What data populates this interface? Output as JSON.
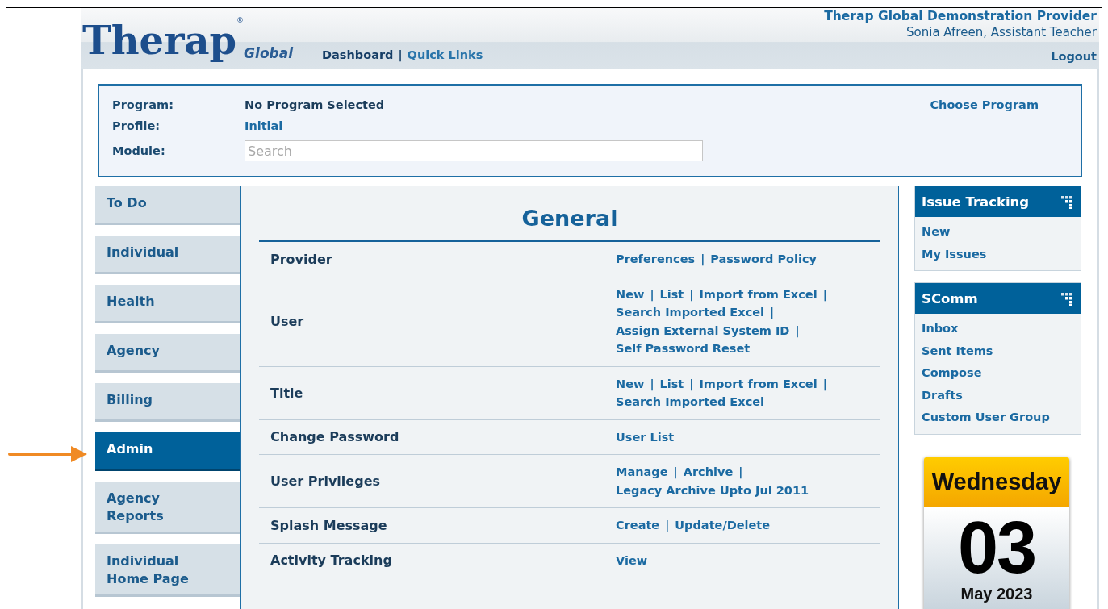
{
  "header": {
    "logo": {
      "name": "Therap",
      "mark": "®",
      "suffix": "Global"
    },
    "nav_links": [
      {
        "label": "Dashboard",
        "selected": true
      },
      {
        "label": "Quick Links",
        "selected": false
      }
    ],
    "separator": "|",
    "provider": "Therap Global Demonstration Provider",
    "user": "Sonia Afreen, Assistant Teacher",
    "logout": "Logout"
  },
  "context": {
    "program_label": "Program:",
    "program_value": "No Program Selected",
    "profile_label": "Profile:",
    "profile_value": "Initial",
    "module_label": "Module:",
    "module_search": {
      "placeholder": "Search"
    },
    "choose_program": "Choose Program"
  },
  "sidebar": {
    "items": [
      {
        "label": "To Do",
        "selected": false
      },
      {
        "label": "Individual",
        "selected": false
      },
      {
        "label": "Health",
        "selected": false
      },
      {
        "label": "Agency",
        "selected": false
      },
      {
        "label": "Billing",
        "selected": false
      },
      {
        "label": "Admin",
        "selected": true
      },
      {
        "label": "Agency Reports",
        "selected": false
      },
      {
        "label": "Individual Home Page",
        "selected": false
      }
    ]
  },
  "main": {
    "title": "General",
    "separator": "|",
    "rows": [
      {
        "label": "Provider",
        "lines": [
          [
            "Preferences",
            "Password Policy"
          ]
        ]
      },
      {
        "label": "User",
        "lines": [
          [
            "New",
            "List",
            "Import from Excel"
          ],
          [
            "Search Imported Excel"
          ],
          [
            "Assign External System ID"
          ],
          [
            "Self Password Reset"
          ]
        ]
      },
      {
        "label": "Title",
        "lines": [
          [
            "New",
            "List",
            "Import from Excel"
          ],
          [
            "Search Imported Excel"
          ]
        ]
      },
      {
        "label": "Change Password",
        "lines": [
          [
            "User List"
          ]
        ]
      },
      {
        "label": "User Privileges",
        "lines": [
          [
            "Manage",
            "Archive"
          ],
          [
            "Legacy Archive Upto Jul 2011"
          ]
        ]
      },
      {
        "label": "Splash Message",
        "lines": [
          [
            "Create",
            "Update/Delete"
          ]
        ]
      },
      {
        "label": "Activity Tracking",
        "lines": [
          [
            "View"
          ]
        ]
      }
    ]
  },
  "widgets": [
    {
      "title": "Issue Tracking",
      "links": [
        "New",
        "My Issues"
      ]
    },
    {
      "title": "SComm",
      "links": [
        "Inbox",
        "Sent Items",
        "Compose",
        "Drafts",
        "Custom User Group"
      ]
    }
  ],
  "calendar": {
    "day": "Wednesday",
    "date": "03",
    "month": "May 2023"
  }
}
